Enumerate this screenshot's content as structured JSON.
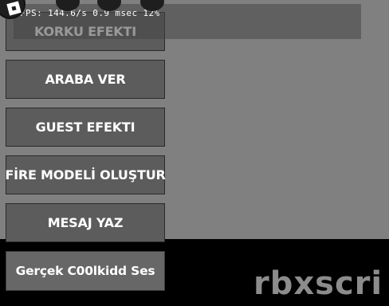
{
  "overlay": {
    "fps_text": "FPS: 144.6/s 0.9 msec 12%"
  },
  "menu": {
    "items": [
      {
        "label": "KORKU EFEKTI"
      },
      {
        "label": "ARABA VER"
      },
      {
        "label": "GUEST EFEKTI"
      },
      {
        "label": "FİRE MODELİ OLUŞTUR"
      },
      {
        "label": "MESAJ YAZ"
      },
      {
        "label": "Gerçek C00lkidd Ses"
      }
    ]
  },
  "watermark": {
    "text": "rbxscri"
  },
  "icons": {
    "logo": "roblox-logo-icon",
    "chat": "chat-icon",
    "backpack": "backpack-icon",
    "menu": "menu-icon"
  },
  "colors": {
    "background": "#808080",
    "button": "#5c5c5c",
    "button_text": "#ffffff",
    "watermark": "#8c8c8c"
  }
}
